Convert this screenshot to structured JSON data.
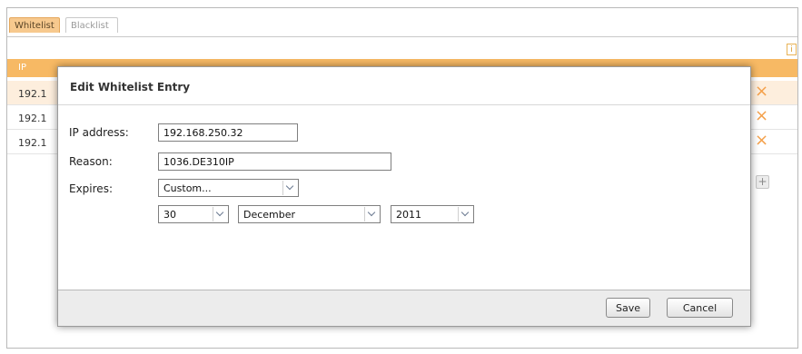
{
  "tabs": [
    {
      "label": "Whitelist",
      "active": true
    },
    {
      "label": "Blacklist",
      "active": false
    }
  ],
  "info_icon": "i",
  "table": {
    "header_first": "IP",
    "rows": [
      {
        "ip": "192.1"
      },
      {
        "ip": "192.1"
      },
      {
        "ip": "192.1"
      }
    ],
    "delete_icon": "×",
    "add_icon": "+"
  },
  "dialog": {
    "title": "Edit Whitelist Entry",
    "ip_label": "IP address:",
    "ip_value": "192.168.250.32",
    "reason_label": "Reason:",
    "reason_value": "1036.DE310IP",
    "expires_label": "Expires:",
    "expires_value": "Custom...",
    "day_value": "30",
    "month_value": "December",
    "year_value": "2011",
    "save_label": "Save",
    "cancel_label": "Cancel"
  },
  "colors": {
    "accent": "#f7b964",
    "active_tab": "#f7c98e",
    "row_alt": "#fdeedd",
    "delete": "#f4a04a"
  }
}
